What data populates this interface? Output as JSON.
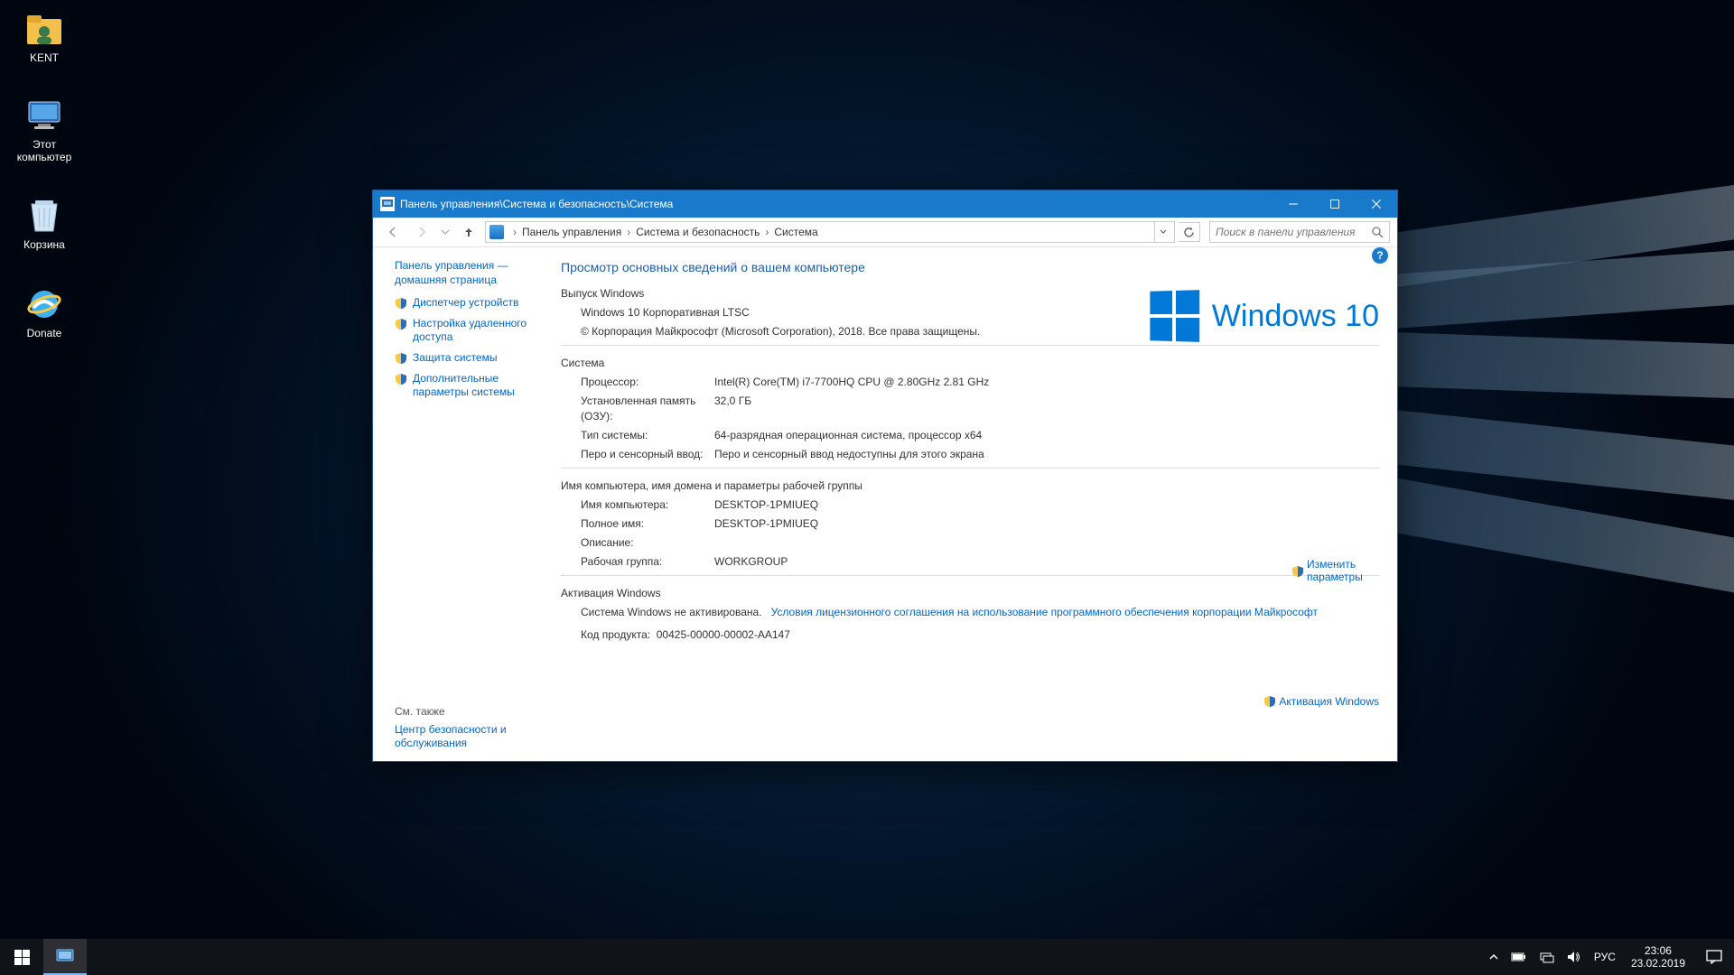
{
  "desktop_icons": [
    {
      "name": "kent",
      "label": "KENT"
    },
    {
      "name": "this-pc",
      "label": "Этот компьютер"
    },
    {
      "name": "recycle-bin",
      "label": "Корзина"
    },
    {
      "name": "donate",
      "label": "Donate"
    }
  ],
  "window": {
    "title": "Панель управления\\Система и безопасность\\Система",
    "breadcrumbs": [
      "Панель управления",
      "Система и безопасность",
      "Система"
    ],
    "search_placeholder": "Поиск в панели управления",
    "sidebar": {
      "home": "Панель управления — домашняя страница",
      "links": [
        "Диспетчер устройств",
        "Настройка удаленного доступа",
        "Защита системы",
        "Дополнительные параметры системы"
      ],
      "see_also_header": "См. также",
      "see_also": "Центр безопасности и обслуживания"
    },
    "content": {
      "heading": "Просмотр основных сведений о вашем компьютере",
      "edition_header": "Выпуск Windows",
      "edition": "Windows 10 Корпоративная LTSC",
      "copyright": "© Корпорация Майкрософт (Microsoft Corporation), 2018. Все права защищены.",
      "logo_text": "Windows 10",
      "system_header": "Система",
      "system": {
        "cpu_k": "Процессор:",
        "cpu_v": "Intel(R) Core(TM) i7-7700HQ CPU @ 2.80GHz   2.81 GHz",
        "ram_k": "Установленная память (ОЗУ):",
        "ram_v": "32,0 ГБ",
        "type_k": "Тип системы:",
        "type_v": "64-разрядная операционная система, процессор x64",
        "pen_k": "Перо и сенсорный ввод:",
        "pen_v": "Перо и сенсорный ввод недоступны для этого экрана"
      },
      "name_header": "Имя компьютера, имя домена и параметры рабочей группы",
      "name": {
        "cn_k": "Имя компьютера:",
        "cn_v": "DESKTOP-1PMIUEQ",
        "fn_k": "Полное имя:",
        "fn_v": "DESKTOP-1PMIUEQ",
        "desc_k": "Описание:",
        "desc_v": "",
        "wg_k": "Рабочая группа:",
        "wg_v": "WORKGROUP"
      },
      "change_settings": "Изменить параметры",
      "activation_header": "Активация Windows",
      "activation_status": "Система Windows не активирована.",
      "eula_link": "Условия лицензионного соглашения на использование программного обеспечения корпорации Майкрософт",
      "product_id_k": "Код продукта:",
      "product_id_v": "00425-00000-00002-AA147",
      "activate_link": "Активация Windows"
    }
  },
  "taskbar": {
    "lang": "РУС",
    "time": "23:06",
    "date": "23.02.2019"
  }
}
